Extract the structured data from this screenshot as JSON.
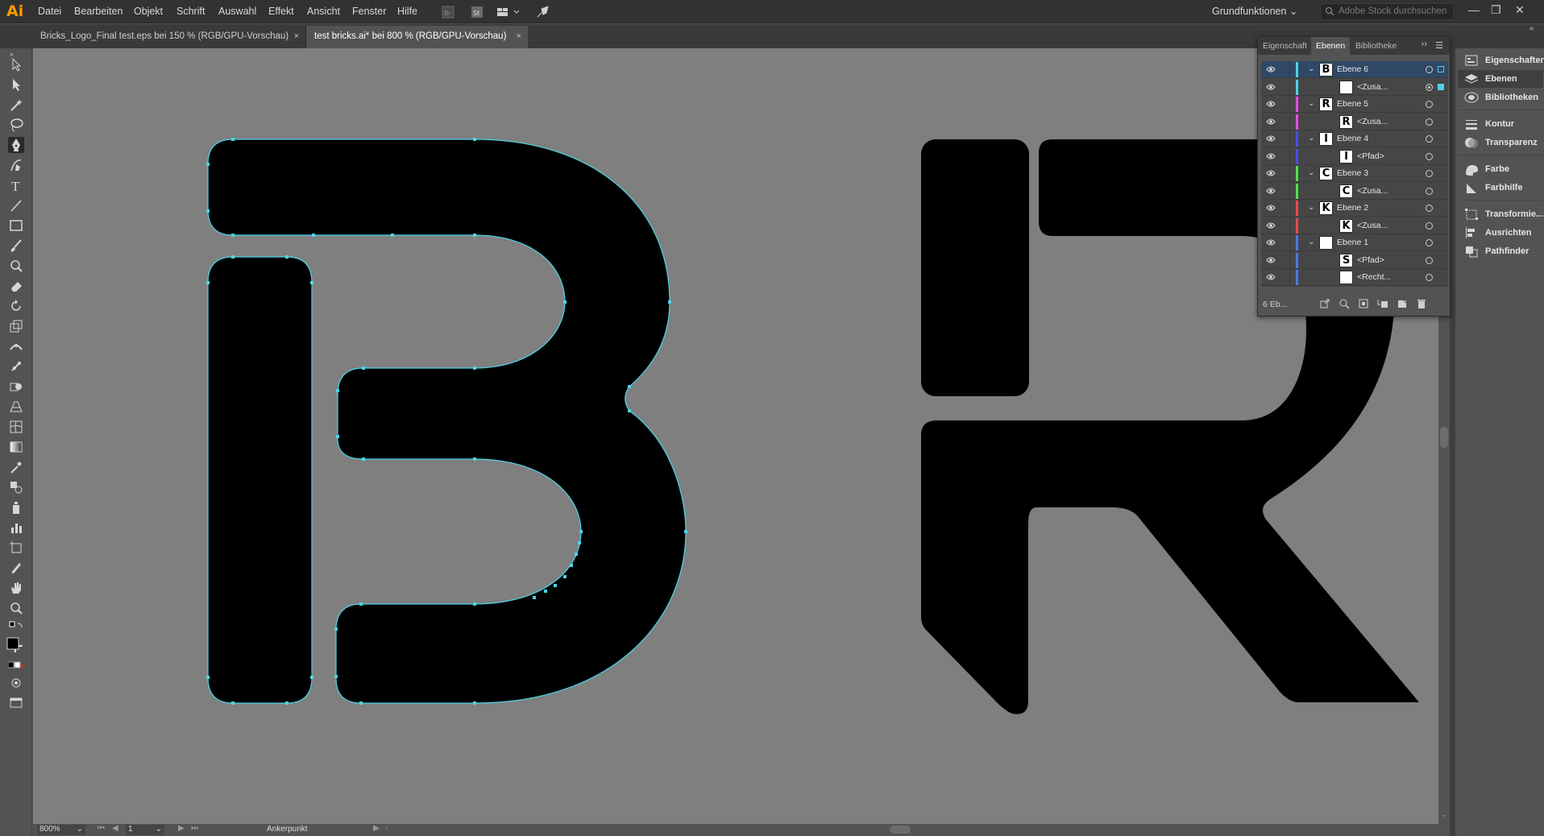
{
  "app": {
    "logo": "Ai",
    "menu": [
      "Datei",
      "Bearbeiten",
      "Objekt",
      "Schrift",
      "Auswahl",
      "Effekt",
      "Ansicht",
      "Fenster",
      "Hilfe"
    ],
    "workspace": "Grundfunktionen",
    "search_placeholder": "Adobe Stock durchsuchen"
  },
  "tabs": [
    {
      "label": "Bricks_Logo_Final test.eps bei 150 % (RGB/GPU-Vorschau)",
      "close": "×"
    },
    {
      "label": "test bricks.ai* bei 800 % (RGB/GPU-Vorschau)",
      "close": "×"
    }
  ],
  "layers_panel": {
    "tabs": [
      "Eigenschaft",
      "Ebenen",
      "Bibliotheke"
    ],
    "active_tab": "Ebenen",
    "rows": [
      {
        "name": "Ebene 6",
        "thumb": "B",
        "color": "#4cd4e6",
        "type": "layer",
        "selected": true
      },
      {
        "name": "<Zusa...",
        "thumb": "",
        "color": "#4cd4e6",
        "type": "sublayer"
      },
      {
        "name": "Ebene 5",
        "thumb": "R",
        "color": "#e64ce6",
        "type": "layer"
      },
      {
        "name": "<Zusa...",
        "thumb": "R",
        "color": "#e64ce6",
        "type": "sublayer"
      },
      {
        "name": "Ebene 4",
        "thumb": "I",
        "color": "#4c4ce6",
        "type": "layer"
      },
      {
        "name": "<Pfad>",
        "thumb": "I",
        "color": "#4c4ce6",
        "type": "sublayer"
      },
      {
        "name": "Ebene 3",
        "thumb": "C",
        "color": "#4ce64c",
        "type": "layer"
      },
      {
        "name": "<Zusa...",
        "thumb": "C",
        "color": "#4ce64c",
        "type": "sublayer"
      },
      {
        "name": "Ebene 2",
        "thumb": "K",
        "color": "#e64c4c",
        "type": "layer"
      },
      {
        "name": "<Zusa...",
        "thumb": "K",
        "color": "#e64c4c",
        "type": "sublayer"
      },
      {
        "name": "Ebene 1",
        "thumb": "",
        "color": "#4c7ae6",
        "type": "layer"
      },
      {
        "name": "<Pfad>",
        "thumb": "S",
        "color": "#4c7ae6",
        "type": "sublayer"
      },
      {
        "name": "<Recht...",
        "thumb": "",
        "color": "#4c7ae6",
        "type": "sublayer"
      }
    ],
    "layer_count": "6 Eb..."
  },
  "dock": {
    "group1": [
      "Eigenschaften",
      "Ebenen",
      "Bibliotheken"
    ],
    "group2": [
      "Kontur",
      "Transparenz"
    ],
    "group3": [
      "Farbe",
      "Farbhilfe"
    ],
    "group4": [
      "Transformie...",
      "Ausrichten",
      "Pathfinder"
    ],
    "active": "Ebenen"
  },
  "status": {
    "zoom": "800%",
    "page": "1",
    "tool_label": "Ankerpunkt"
  },
  "colors": {
    "selection": "#4cd4e6",
    "canvas": "#7f7f7f",
    "accent_logo": "#ff9a00"
  }
}
